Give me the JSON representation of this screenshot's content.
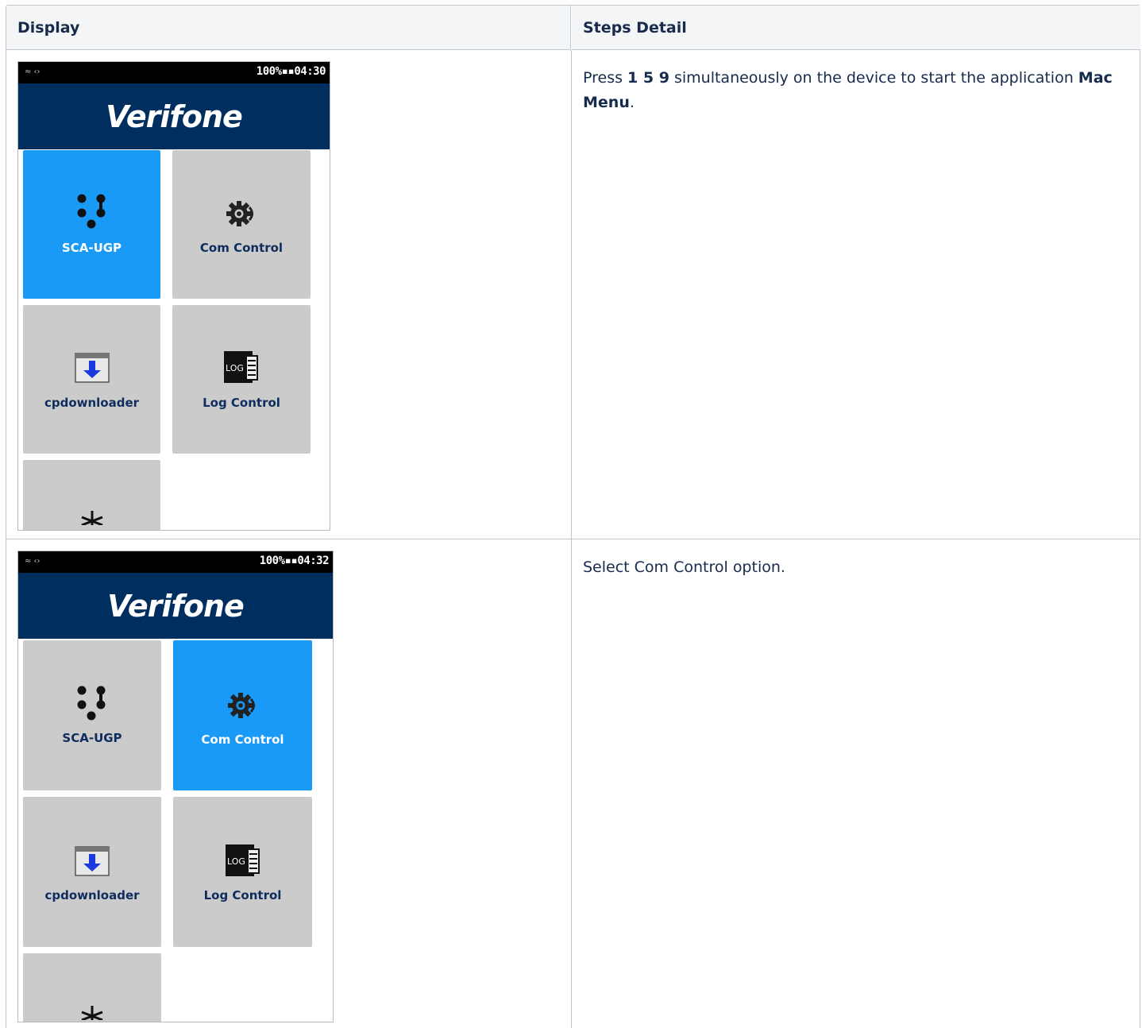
{
  "table": {
    "headers": [
      "Display",
      "Steps Detail"
    ]
  },
  "steps": [
    {
      "screen": {
        "status_left": "≈ ‹›",
        "status_right": "100%▪▪04:30",
        "brand": "Verifone",
        "active_tile": "sca-ugp",
        "tiles": [
          "SCA-UGP",
          "Com Control",
          "cpdownloader",
          "Log Control"
        ]
      },
      "text_parts": {
        "press": "Press ",
        "keys": "1 5 9",
        "middle": " simultaneously on the device to start the application ",
        "app": "Mac Menu",
        "end": "."
      }
    },
    {
      "screen": {
        "status_left": "≈ ‹›",
        "status_right": "100%▪▪04:32",
        "brand": "Verifone",
        "active_tile": "com-control",
        "tiles": [
          "SCA-UGP",
          "Com Control",
          "cpdownloader",
          "Log Control"
        ]
      },
      "text": "Select Com Control option."
    }
  ],
  "colors": {
    "header_bg": "#f4f5f7",
    "border": "#c1c7d0",
    "brand_bar": "#002f5f",
    "active_tile": "#1a9af7",
    "tile": "#cbcbcb"
  },
  "icons": [
    "sca-ugp-icon",
    "gear-signal-icon",
    "download-icon",
    "log-book-icon",
    "partial-gear-icon"
  ]
}
